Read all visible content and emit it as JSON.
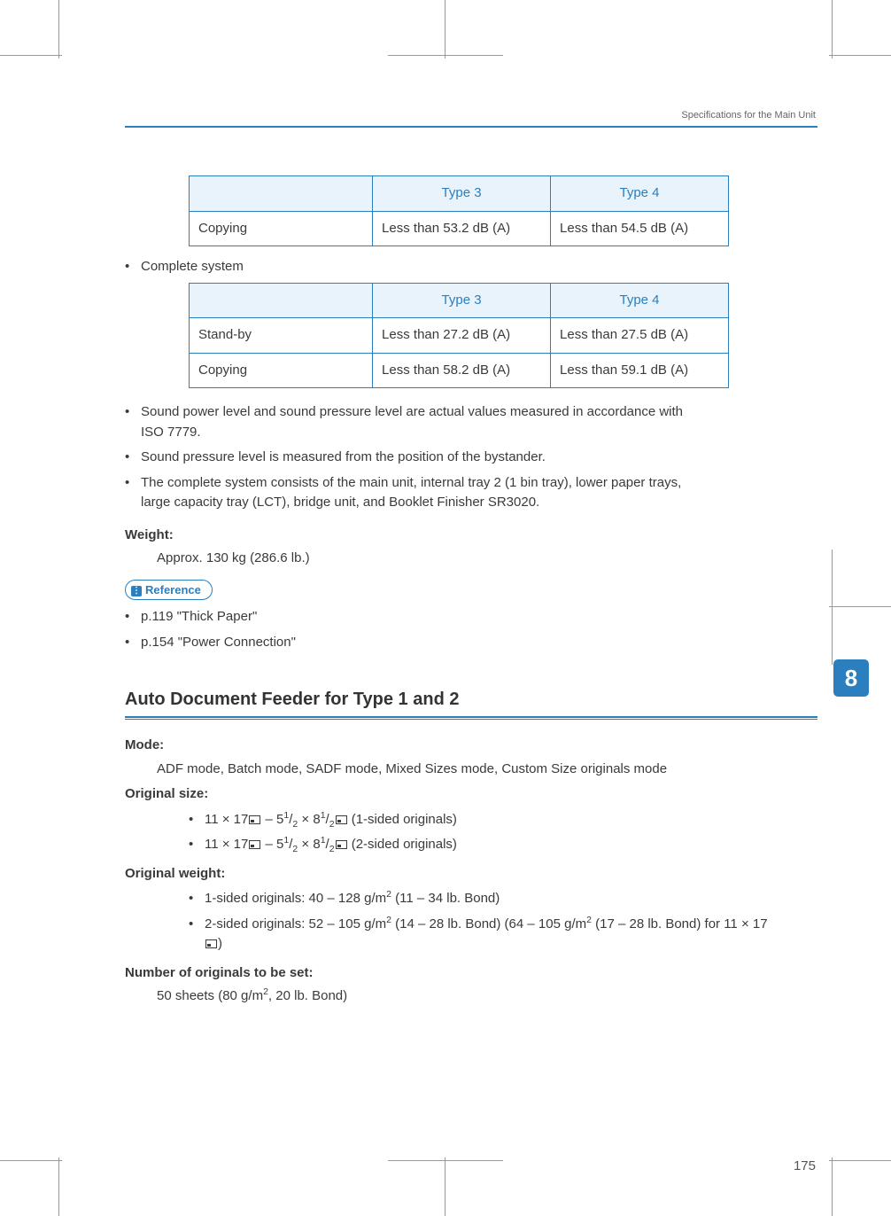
{
  "running_head": "Specifications for the Main Unit",
  "table1": {
    "headers": [
      "Type 3",
      "Type 4"
    ],
    "rows": [
      {
        "label": "Copying",
        "c1": "Less than 53.2 dB (A)",
        "c2": "Less than 54.5 dB (A)"
      }
    ]
  },
  "bullet_complete_system": "Complete system",
  "table2": {
    "headers": [
      "Type 3",
      "Type 4"
    ],
    "rows": [
      {
        "label": "Stand-by",
        "c1": "Less than 27.2 dB (A)",
        "c2": "Less than 27.5 dB (A)"
      },
      {
        "label": "Copying",
        "c1": "Less than 58.2 dB (A)",
        "c2": "Less than 59.1 dB (A)"
      }
    ]
  },
  "notes": [
    "Sound power level and sound pressure level are actual values measured in accordance with ISO 7779.",
    "Sound pressure level is measured from the position of the bystander.",
    "The complete system consists of the main unit, internal tray 2 (1 bin tray), lower paper trays, large capacity tray (LCT), bridge unit, and Booklet Finisher SR3020."
  ],
  "weight_label": "Weight:",
  "weight_value": "Approx. 130 kg (286.6 lb.)",
  "reference_label": "Reference",
  "reference_items": [
    "p.119 \"Thick Paper\"",
    "p.154 \"Power Connection\""
  ],
  "section_title": "Auto Document Feeder for Type 1 and 2",
  "mode_label": "Mode:",
  "mode_value": "ADF mode, Batch mode, SADF mode, Mixed Sizes mode, Custom Size originals mode",
  "orig_size_label": "Original size:",
  "orig_size": {
    "prefix": "11 × 17",
    "mid": " – 5",
    "frac_a": "1",
    "frac_b": "2",
    "mid2": " × 8",
    "suffix1": " (1-sided originals)",
    "suffix2": " (2-sided originals)"
  },
  "orig_weight_label": "Original weight:",
  "orig_weight": {
    "line1_pre": "1-sided originals: 40 – 128 g/m",
    "line1_post": " (11 – 34 lb. Bond)",
    "line2_pre": "2-sided originals: 52 – 105 g/m",
    "line2_mid": " (14 – 28 lb. Bond) (64 – 105 g/m",
    "line2_post": " (17 – 28 lb. Bond) for 11 × 17",
    "line2_end": ")"
  },
  "num_orig_label": "Number of originals to be set:",
  "num_orig_value_pre": "50 sheets (80 g/m",
  "num_orig_value_post": ", 20 lb. Bond)",
  "chapter_num": "8",
  "page_number": "175"
}
